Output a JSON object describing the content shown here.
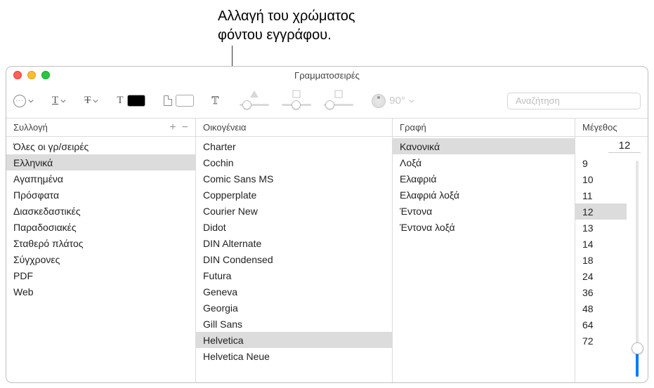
{
  "annotation": {
    "line1": "Αλλαγή του χρώματος",
    "line2": "φόντου εγγράφου."
  },
  "window": {
    "title": "Γραμματοσειρές"
  },
  "toolbar": {
    "angle_value": "90°",
    "search_placeholder": "Αναζήτηση"
  },
  "columns": {
    "collection": {
      "header": "Συλλογή",
      "selected_index": 1,
      "items": [
        "Όλες οι γρ/σειρές",
        "Ελληνικά",
        "Αγαπημένα",
        "Πρόσφατα",
        "Διασκεδαστικές",
        "Παραδοσιακές",
        "Σταθερό πλάτος",
        "Σύγχρονες",
        "PDF",
        "Web"
      ]
    },
    "family": {
      "header": "Οικογένεια",
      "selected_index": 12,
      "items": [
        "Charter",
        "Cochin",
        "Comic Sans MS",
        "Copperplate",
        "Courier New",
        "Didot",
        "DIN Alternate",
        "DIN Condensed",
        "Futura",
        "Geneva",
        "Georgia",
        "Gill Sans",
        "Helvetica",
        "Helvetica Neue"
      ]
    },
    "typeface": {
      "header": "Γραφή",
      "selected_index": 0,
      "items": [
        "Κανονικά",
        "Λοξά",
        "Ελαφριά",
        "Ελαφριά λοξά",
        "Έντονα",
        "Έντονα λοξά"
      ]
    },
    "size": {
      "header": "Μέγεθος",
      "current_value": "12",
      "selected_index": 3,
      "items": [
        "9",
        "10",
        "11",
        "12",
        "13",
        "14",
        "18",
        "24",
        "36",
        "48",
        "64",
        "72"
      ]
    }
  }
}
